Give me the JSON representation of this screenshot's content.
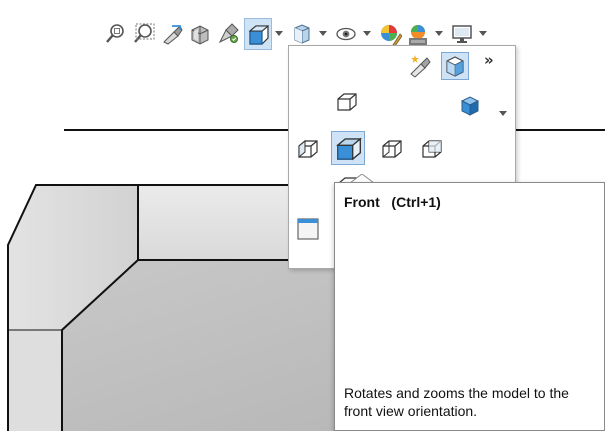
{
  "toolbar": {
    "items": [
      {
        "icon": "zoom-to-fit-icon"
      },
      {
        "icon": "zoom-to-area-icon"
      },
      {
        "icon": "previous-view-icon"
      },
      {
        "icon": "section-view-icon"
      },
      {
        "icon": "dynamic-annotation-views-icon"
      },
      {
        "icon": "view-orientation-icon",
        "selected": true,
        "has_dropdown": true
      },
      {
        "icon": "display-style-icon",
        "has_dropdown": true
      },
      {
        "icon": "hide-show-items-icon",
        "has_dropdown": true
      },
      {
        "icon": "edit-appearance-icon"
      },
      {
        "icon": "apply-scene-icon",
        "has_dropdown": true
      },
      {
        "icon": "view-settings-icon",
        "has_dropdown": true
      }
    ]
  },
  "flyout": {
    "expand_label": "»",
    "items": [
      {
        "icon": "new-view-icon"
      },
      {
        "icon": "view-selector-icon",
        "selected": true
      },
      {
        "icon": "top-view-icon"
      },
      {
        "icon": "isometric-view-icon",
        "has_dropdown": true
      },
      {
        "icon": "left-view-icon"
      },
      {
        "icon": "front-view-icon",
        "selected": true
      },
      {
        "icon": "right-view-icon"
      },
      {
        "icon": "back-view-icon"
      },
      {
        "icon": "bottom-view-icon"
      },
      {
        "icon": "single-view-icon"
      }
    ]
  },
  "tooltip": {
    "title": "Front   (Ctrl+1)",
    "description": "Rotates and zooms the model to the front view orientation."
  },
  "colors": {
    "accent_blue": "#3a8fd6",
    "selection_bg": "#cfe3f7",
    "model_face_light": "#e6e6e6",
    "model_face_dark": "#bcbcbc"
  }
}
